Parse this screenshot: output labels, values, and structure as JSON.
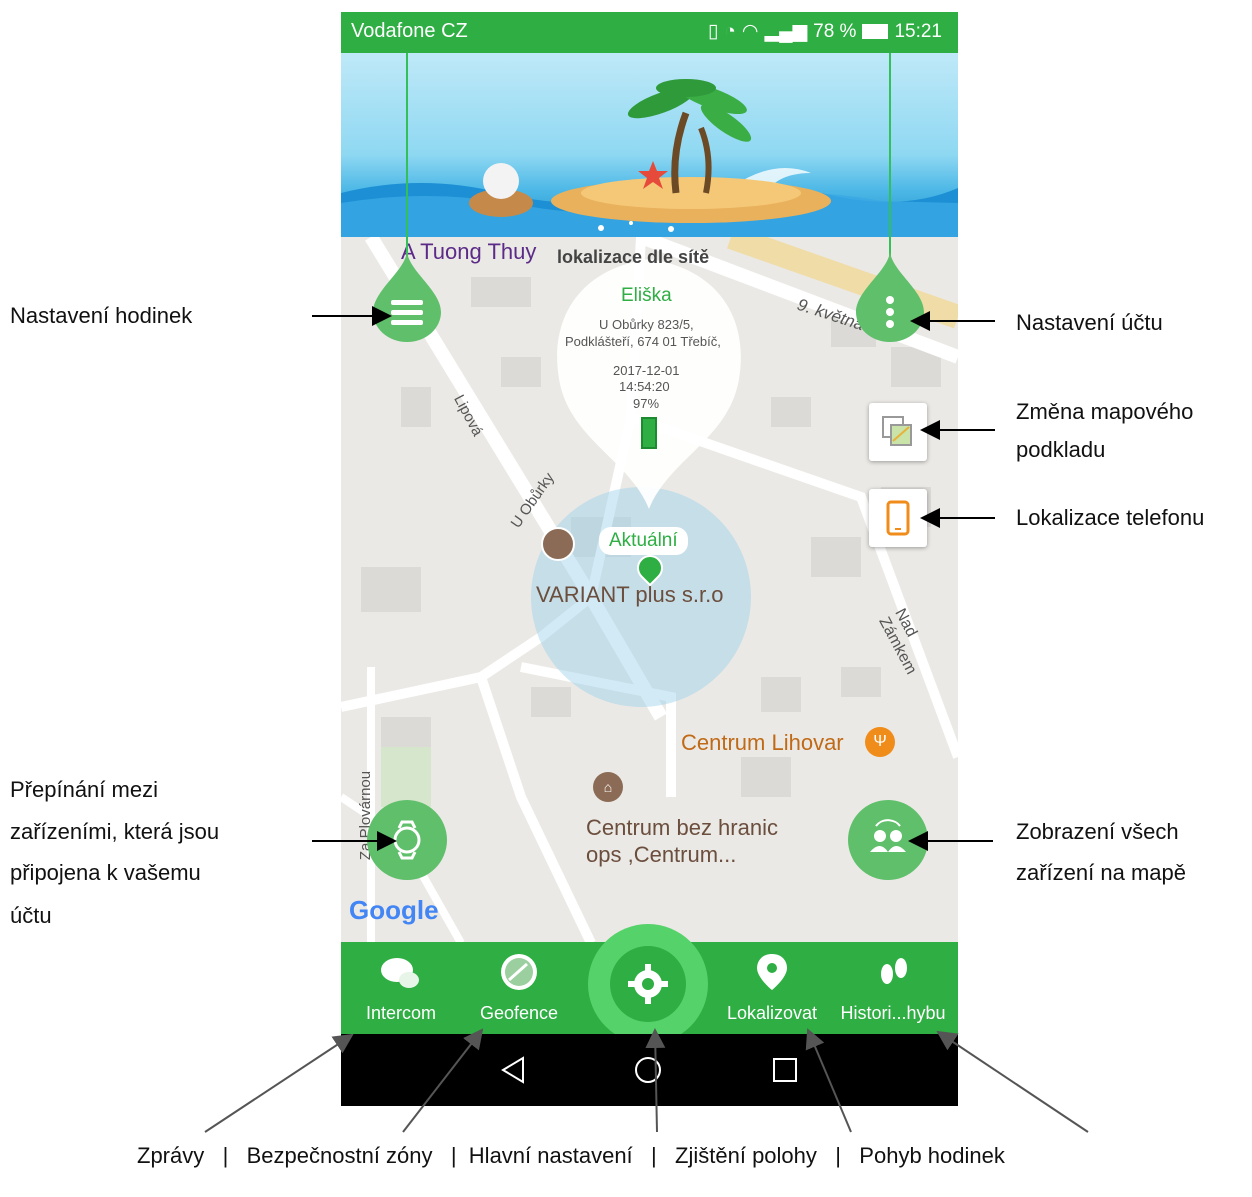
{
  "status_bar": {
    "carrier": "Vodafone CZ",
    "battery": "78 %",
    "time": "15:21"
  },
  "map": {
    "place_labels": {
      "tuong_thuy": "A Tuong Thuy",
      "street_9_kvetna": "9. května",
      "street_lipova": "Lipová",
      "street_u_oburky": "U Obůrky",
      "street_nad_zamkem": "Nad Zámkem",
      "street_za_plovarnou": "Za Plovárnou",
      "variant": "VARIANT plus s.r.o",
      "centrum_lihovar": "Centrum Lihovar",
      "centrum_bez_hranic_1": "Centrum bez hranic",
      "centrum_bez_hranic_2": "ops ,Centrum..."
    },
    "google_logo": "Google",
    "current_badge": "Aktuální"
  },
  "info_bubble": {
    "mode": "lokalizace dle sítě",
    "name": "Eliška",
    "address_line1": "U Obůrky 823/5,",
    "address_line2": "Podklášteří, 674 01 Třebíč,",
    "date": "2017-12-01",
    "time": "14:54:20",
    "battery": "97%"
  },
  "bottom_tabs": [
    {
      "label": "Intercom",
      "icon": "chat-bubbles-icon"
    },
    {
      "label": "Geofence",
      "icon": "radar-icon"
    },
    {
      "label": "",
      "icon": "gear-icon"
    },
    {
      "label": "Lokalizovat",
      "icon": "map-pin-icon"
    },
    {
      "label": "Histori...hybu",
      "icon": "footprints-icon"
    }
  ],
  "annotations": {
    "watch_settings": "Nastavení hodinek",
    "account_settings": "Nastavení účtu",
    "map_layer_1": "Změna mapového",
    "map_layer_2": "podkladu",
    "phone_location": "Lokalizace telefonu",
    "switch_1": "Přepínání mezi",
    "switch_2": "zařízeními, která jsou",
    "switch_3": "připojena k vašemu",
    "switch_4": "účtu",
    "all_devices_1": "Zobrazení všech",
    "all_devices_2": "zařízení na mapě",
    "bottom_caption": "Zprávy   |   Bezpečnostní zóny   |  Hlavní nastavení   |   Zjištění polohy   |   Pohyb hodinek"
  },
  "colors": {
    "primary_green": "#2eae43",
    "light_green": "#5fbf6b",
    "orange": "#f08c1a"
  }
}
